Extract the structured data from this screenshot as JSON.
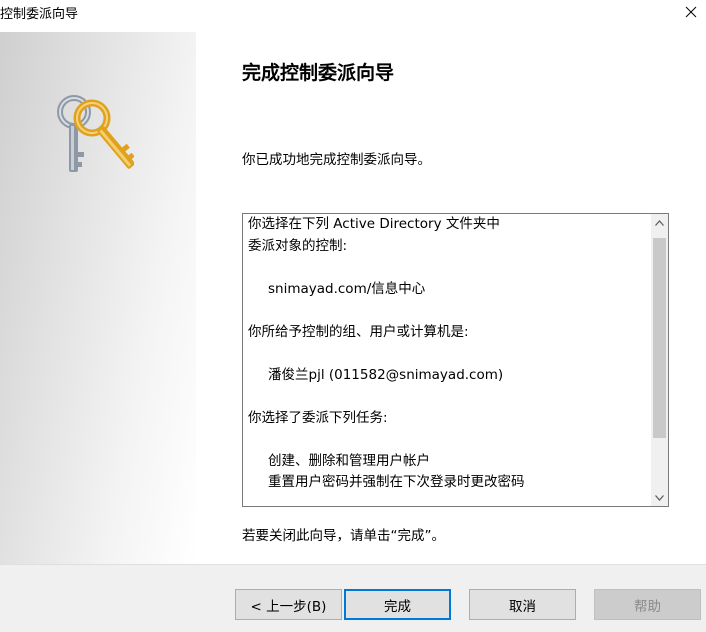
{
  "window": {
    "title": "控制委派向导",
    "close_symbol": "✕"
  },
  "page": {
    "heading": "完成控制委派向导",
    "intro": "你已成功地完成控制委派向导。",
    "summary": {
      "line1": "你选择在下列 Active Directory 文件夹中",
      "line2": "委派对象的控制:",
      "folder": "snimayad.com/信息中心",
      "principals_label": "你所给予控制的组、用户或计算机是:",
      "principal": "潘俊兰pjl (011582@snimayad.com)",
      "tasks_label": "你选择了委派下列任务:",
      "task1": "创建、删除和管理用户帐户",
      "task2": "重置用户密码并强制在下次登录时更改密码"
    },
    "closing_note": "若要关闭此向导，请单击“完成”。"
  },
  "buttons": {
    "back": "< 上一步(B)",
    "finish": "完成",
    "cancel": "取消",
    "help": "帮助"
  },
  "colors": {
    "accent": "#0078d7",
    "key_gold": "#e0a21e",
    "key_silver": "#8e98a6"
  },
  "icons": {
    "side_art": "keys-icon",
    "close": "close-icon",
    "scroll_up": "chevron-up-icon",
    "scroll_down": "chevron-down-icon"
  }
}
